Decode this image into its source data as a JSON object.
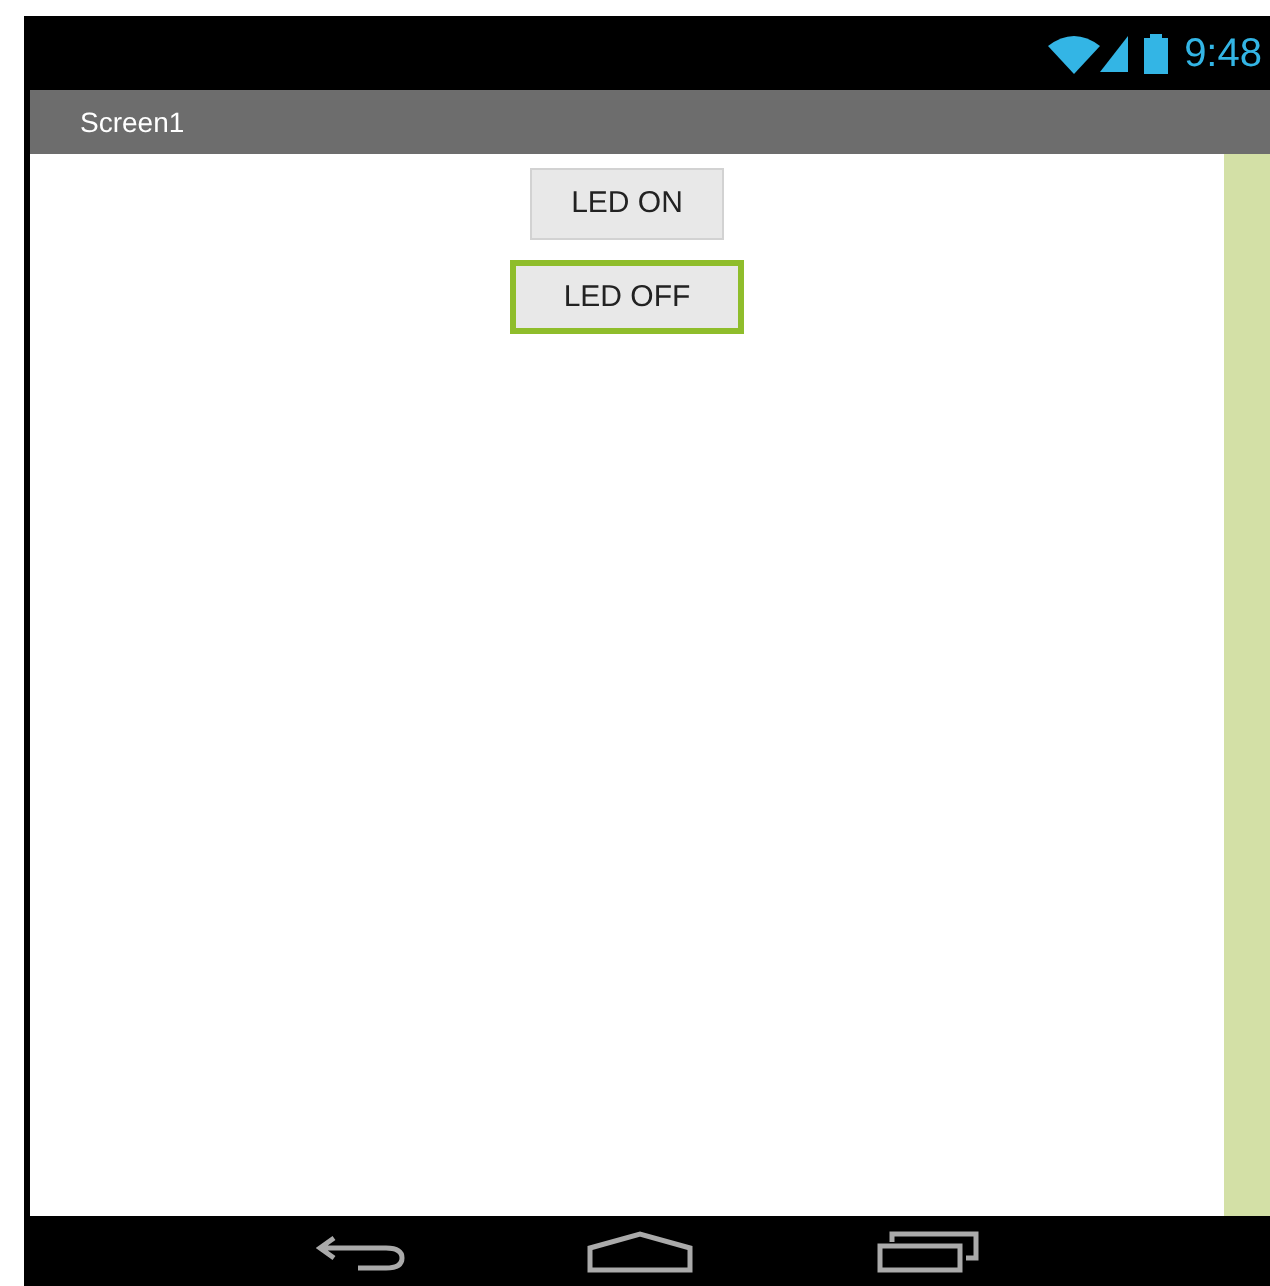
{
  "status_bar": {
    "time": "9:48"
  },
  "title_bar": {
    "title": "Screen1"
  },
  "buttons": [
    {
      "label": "LED ON",
      "focused": false
    },
    {
      "label": "LED OFF",
      "focused": true
    }
  ]
}
